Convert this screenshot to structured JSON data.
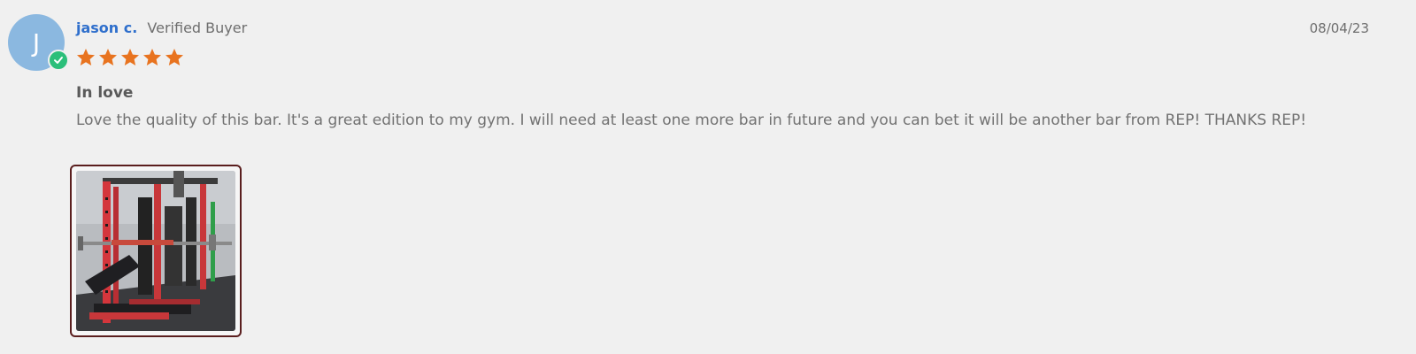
{
  "review": {
    "avatar_initial": "J",
    "author": "jason c.",
    "verified_label": "Verified Buyer",
    "date": "08/04/23",
    "rating": 5,
    "rating_max": 5,
    "title": "In love",
    "body": "Love the quality of this bar. It's a great edition to my gym. I will need at least one more bar in future and you can bet it will be another bar from REP! THANKS REP!"
  },
  "icons": {
    "verified": "checkmark-icon",
    "star": "star-icon"
  },
  "colors": {
    "author": "#2f6fcc",
    "star": "#e8731f",
    "verified_badge": "#2bbf7a",
    "avatar": "#8bb8e0",
    "photo_border": "#5a1e1e",
    "background": "#f0f0f0"
  }
}
